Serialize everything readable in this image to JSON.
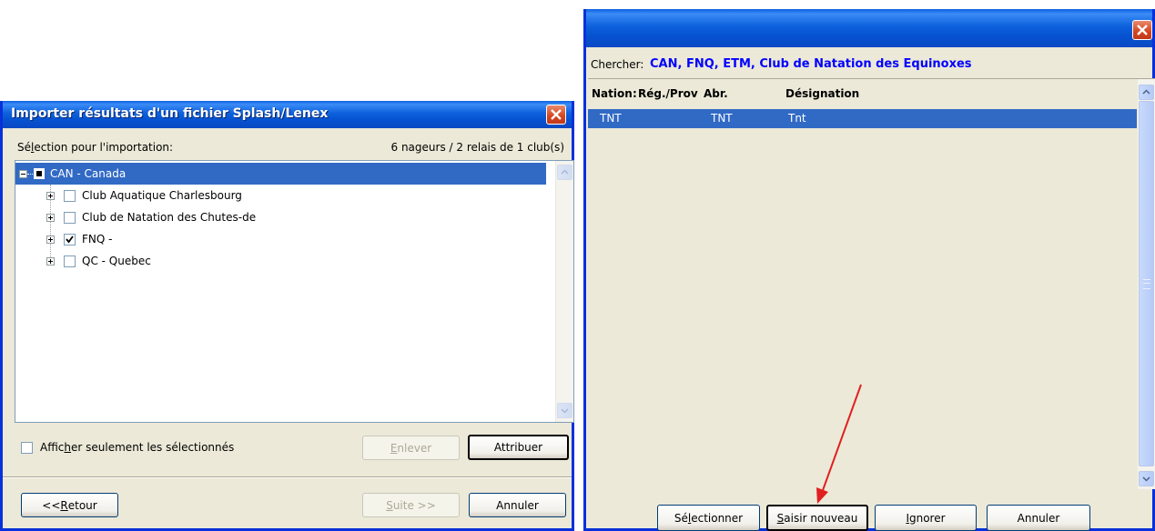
{
  "left_dialog": {
    "title": "Importer résultats d'un fichier Splash/Lenex",
    "selection_label_pre": "Sé",
    "selection_label_acc": "l",
    "selection_label_post": "ection pour l'importation:",
    "summary": "6 nageurs / 2 relais de 1 club(s)",
    "tree": {
      "root": "CAN - Canada",
      "children": [
        {
          "label": "Club Aquatique Charlesbourg",
          "checked": false
        },
        {
          "label": "Club de Natation des Chutes-de",
          "checked": false
        },
        {
          "label": "FNQ -",
          "checked": true
        },
        {
          "label": "QC - Quebec",
          "checked": false
        }
      ]
    },
    "filter_checkbox": {
      "pre": "Affic",
      "acc": "h",
      "post": "er seulement les sélectionnés",
      "checked": false
    },
    "buttons": {
      "enlever": {
        "acc": "E",
        "rest": "nlever"
      },
      "attribuer": "Attribuer",
      "retour": {
        "pre": "<< ",
        "acc": "R",
        "rest": "etour"
      },
      "suite": {
        "acc": "S",
        "rest": "uite >>"
      },
      "annuler": "Annuler"
    }
  },
  "right_dialog": {
    "search_label": "Chercher:",
    "search_value": "CAN, FNQ, ETM, Club de Natation des Equinoxes",
    "columns": [
      "Nation",
      "Rég./Prov",
      "Abr.",
      "Désignation"
    ],
    "rows": [
      {
        "nation": "TNT",
        "abr": "TNT",
        "designation": "Tnt",
        "selected": true
      }
    ],
    "buttons": {
      "selectionner": {
        "pre": "Sé",
        "acc": "l",
        "rest": "ectionner"
      },
      "saisir": {
        "acc": "S",
        "rest": "aisir nouveau"
      },
      "ignorer": {
        "acc": "I",
        "rest": "gnorer"
      },
      "annuler": "Annuler"
    }
  },
  "colors": {
    "selection": "#316ac5",
    "xp_face": "#ece9d8",
    "search_text": "#0000ff",
    "annotation_arrow": "#e02020"
  }
}
